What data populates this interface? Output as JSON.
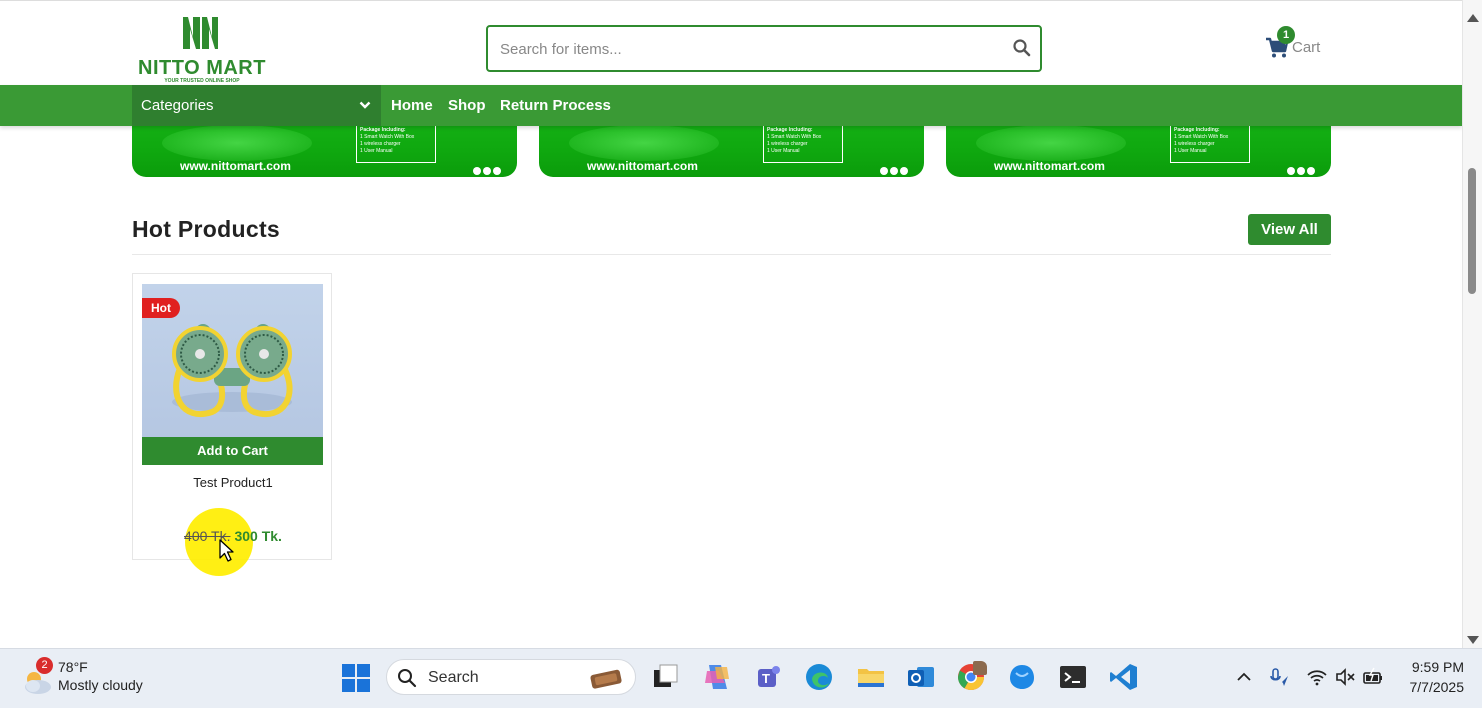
{
  "header": {
    "logo_name": "NITTO MART",
    "logo_tagline": "YOUR TRUSTED ONLINE SHOP",
    "search_placeholder": "Search for items...",
    "cart_label": "Cart",
    "cart_count": "1"
  },
  "nav": {
    "categories_label": "Categories",
    "links": [
      "Home",
      "Shop",
      "Return Process"
    ]
  },
  "banners": [
    {
      "url": "www.nittomart.com",
      "box_title": "Package Including:",
      "box_lines": [
        "1 Smart Watch With Box",
        "1 wireless charger",
        "1 User Manual"
      ]
    },
    {
      "url": "www.nittomart.com",
      "box_title": "Package Including:",
      "box_lines": [
        "1 Smart Watch With Box",
        "1 wireless charger",
        "1 User Manual"
      ]
    },
    {
      "url": "www.nittomart.com",
      "box_title": "Package Including:",
      "box_lines": [
        "1 Smart Watch With Box",
        "1 wireless charger",
        "1 User Manual"
      ]
    }
  ],
  "hot_products": {
    "title": "Hot Products",
    "view_all_label": "View All",
    "products": [
      {
        "badge": "Hot",
        "name": "Test Product1",
        "add_to_cart_label": "Add to Cart",
        "old_price": "400 Tk.",
        "new_price": "300 Tk.",
        "image_icon": "neck-fan-image"
      }
    ]
  },
  "taskbar": {
    "weather_badge": "2",
    "temperature": "78°F",
    "condition": "Mostly cloudy",
    "search_label": "Search",
    "time": "9:59 PM",
    "date": "7/7/2025",
    "apps": [
      "file-explorer-icon",
      "task-view-icon",
      "copilot-icon",
      "teams-icon",
      "edge-icon",
      "folder-icon",
      "outlook-icon",
      "chrome-icon",
      "app-icon",
      "terminal-icon",
      "vscode-icon"
    ]
  },
  "colors": {
    "brand_green": "#2f8b2f",
    "nav_green": "#3a9a35",
    "hot_red": "#e02020"
  }
}
